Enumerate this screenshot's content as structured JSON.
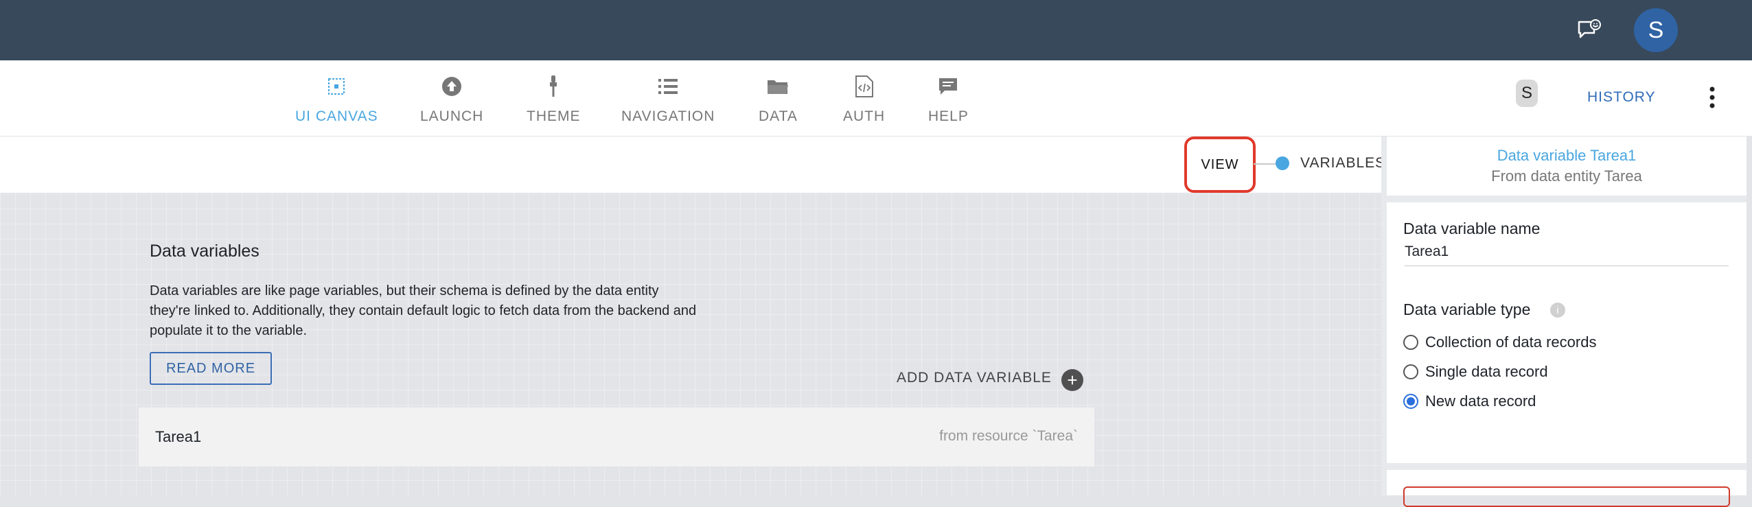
{
  "topbar": {
    "avatar_initial": "S"
  },
  "nav": {
    "items": [
      {
        "label": "UI CANVAS",
        "icon": "canvas-icon"
      },
      {
        "label": "LAUNCH",
        "icon": "launch-icon"
      },
      {
        "label": "THEME",
        "icon": "theme-brush-icon"
      },
      {
        "label": "NAVIGATION",
        "icon": "navigation-list-icon"
      },
      {
        "label": "DATA",
        "icon": "folder-icon"
      },
      {
        "label": "AUTH",
        "icon": "auth-code-icon"
      },
      {
        "label": "HELP",
        "icon": "help-chat-icon"
      }
    ],
    "active": "UI CANVAS",
    "user_initial": "S",
    "history_label": "HISTORY"
  },
  "toggle": {
    "view_label": "VIEW",
    "variables_label": "VARIABLES"
  },
  "main": {
    "title": "Data variables",
    "description": "Data variables are like page variables, but their schema is defined by the data entity they're linked to. Additionally, they contain default logic to fetch data from the backend and populate it to the variable.",
    "read_more_label": "READ MORE",
    "add_variable_label": "ADD DATA VARIABLE",
    "variables": [
      {
        "name": "Tarea1",
        "source": "from resource `Tarea`"
      }
    ]
  },
  "panel": {
    "header_title": "Data variable Tarea1",
    "header_subtitle": "From data entity Tarea",
    "name_label": "Data variable name",
    "name_value": "Tarea1",
    "type_label": "Data variable type",
    "type_options": [
      {
        "label": "Collection of data records",
        "checked": false
      },
      {
        "label": "Single data record",
        "checked": false
      },
      {
        "label": "New data record",
        "checked": true
      }
    ]
  },
  "colors": {
    "topbar": "#38495b",
    "accent": "#49a6e0",
    "link": "#2f63a4",
    "highlight": "#e03a2b"
  }
}
